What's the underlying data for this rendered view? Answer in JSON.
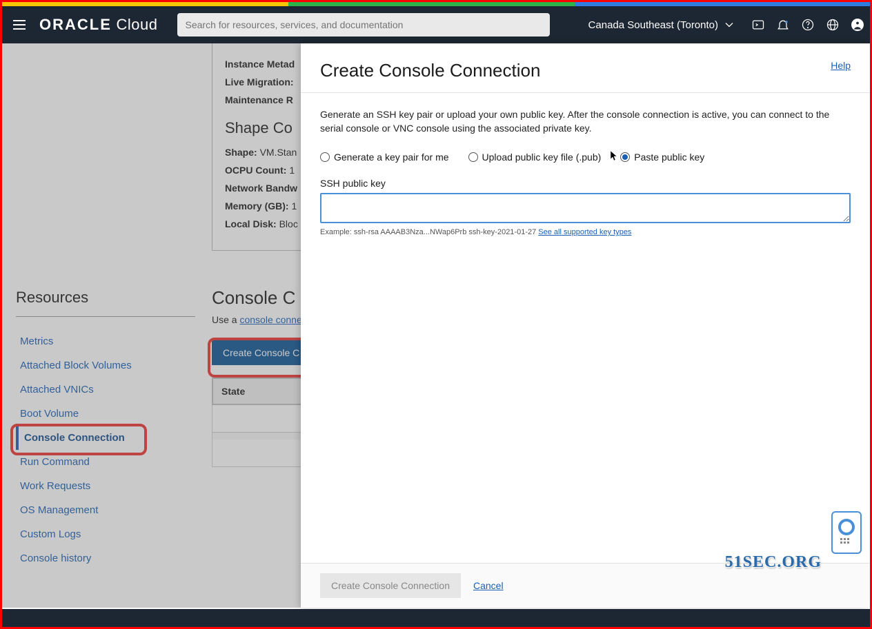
{
  "header": {
    "logo_brand": "ORACLE",
    "logo_suffix": "Cloud",
    "search_placeholder": "Search for resources, services, and documentation",
    "region": "Canada Southeast (Toronto)"
  },
  "instance": {
    "meta_label": "Instance Metad",
    "live_migration_label": "Live Migration:",
    "maintenance_label": "Maintenance R",
    "shape_heading": "Shape Co",
    "shape_label": "Shape:",
    "shape_value": "VM.Stan",
    "ocpu_label": "OCPU Count:",
    "ocpu_value": "1",
    "bandwidth_label": "Network Bandw",
    "memory_label": "Memory (GB):",
    "memory_value": "1",
    "disk_label": "Local Disk:",
    "disk_value": "Bloc"
  },
  "resources": {
    "title": "Resources",
    "items": [
      "Metrics",
      "Attached Block Volumes",
      "Attached VNICs",
      "Boot Volume",
      "Console Connection",
      "Run Command",
      "Work Requests",
      "OS Management",
      "Custom Logs",
      "Console history"
    ],
    "active_index": 4
  },
  "console_section": {
    "title": "Console C",
    "desc_prefix": "Use a ",
    "desc_link": "console conne",
    "create_btn": "Create Console C",
    "table_col": "State"
  },
  "panel": {
    "title": "Create Console Connection",
    "help": "Help",
    "intro": "Generate an SSH key pair or upload your own public key. After the console connection is active, you can connect to the serial console or VNC console using the associated private key.",
    "radios": {
      "generate": "Generate a key pair for me",
      "upload": "Upload public key file (.pub)",
      "paste": "Paste public key"
    },
    "selected_radio": "paste",
    "ssh_label": "SSH public key",
    "example_prefix": "Example: ssh-rsa AAAAB3Nza...NWap6Prb ssh-key-2021-01-27 ",
    "example_link": "See all supported key types",
    "footer_btn": "Create Console Connection",
    "cancel": "Cancel"
  },
  "watermark": "51SEC.ORG"
}
